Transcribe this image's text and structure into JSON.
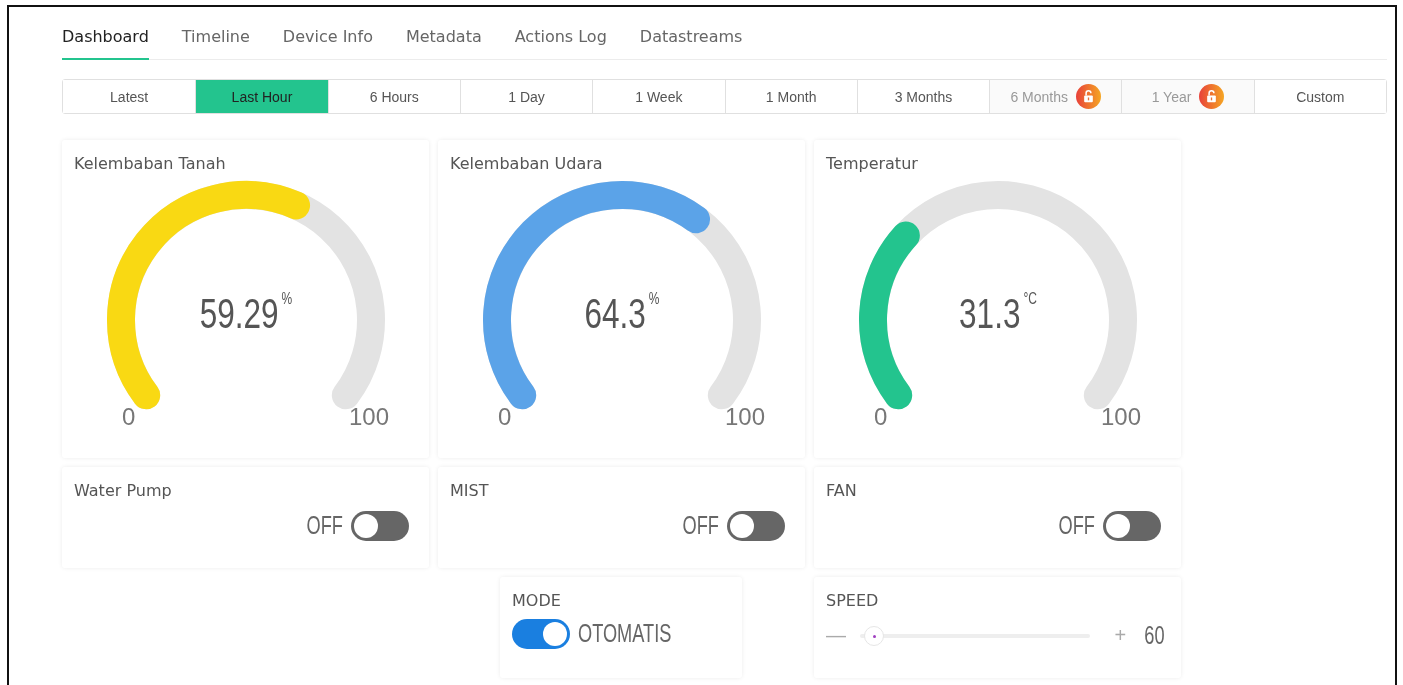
{
  "tabs": [
    {
      "label": "Dashboard",
      "selected": true
    },
    {
      "label": "Timeline",
      "selected": false
    },
    {
      "label": "Device Info",
      "selected": false
    },
    {
      "label": "Metadata",
      "selected": false
    },
    {
      "label": "Actions Log",
      "selected": false
    },
    {
      "label": "Datastreams",
      "selected": false
    }
  ],
  "time_ranges": [
    {
      "label": "Latest",
      "selected": false,
      "locked": false
    },
    {
      "label": "Last Hour",
      "selected": true,
      "locked": false
    },
    {
      "label": "6 Hours",
      "selected": false,
      "locked": false
    },
    {
      "label": "1 Day",
      "selected": false,
      "locked": false
    },
    {
      "label": "1 Week",
      "selected": false,
      "locked": false
    },
    {
      "label": "1 Month",
      "selected": false,
      "locked": false
    },
    {
      "label": "3 Months",
      "selected": false,
      "locked": false
    },
    {
      "label": "6 Months",
      "selected": false,
      "locked": true
    },
    {
      "label": "1 Year",
      "selected": false,
      "locked": true
    },
    {
      "label": "Custom",
      "selected": false,
      "locked": false
    }
  ],
  "gauges": [
    {
      "title": "Kelembaban Tanah",
      "value": "59.29",
      "unit": "%",
      "min": "0",
      "max": "100",
      "color": "#f9d913"
    },
    {
      "title": "Kelembaban Udara",
      "value": "64.3",
      "unit": "%",
      "min": "0",
      "max": "100",
      "color": "#5ba3e8"
    },
    {
      "title": "Temperatur",
      "value": "31.3",
      "unit": "°C",
      "min": "0",
      "max": "100",
      "color": "#23c48e"
    }
  ],
  "switches": [
    {
      "title": "Water Pump",
      "label": "OFF",
      "on": false
    },
    {
      "title": "MIST",
      "label": "OFF",
      "on": false
    },
    {
      "title": "FAN",
      "label": "OFF",
      "on": false
    }
  ],
  "mode": {
    "title": "MODE",
    "label": "OTOMATIS",
    "on": true
  },
  "speed": {
    "title": "SPEED",
    "minus": "—",
    "plus": "+",
    "value": "60",
    "level": 0.02
  }
}
